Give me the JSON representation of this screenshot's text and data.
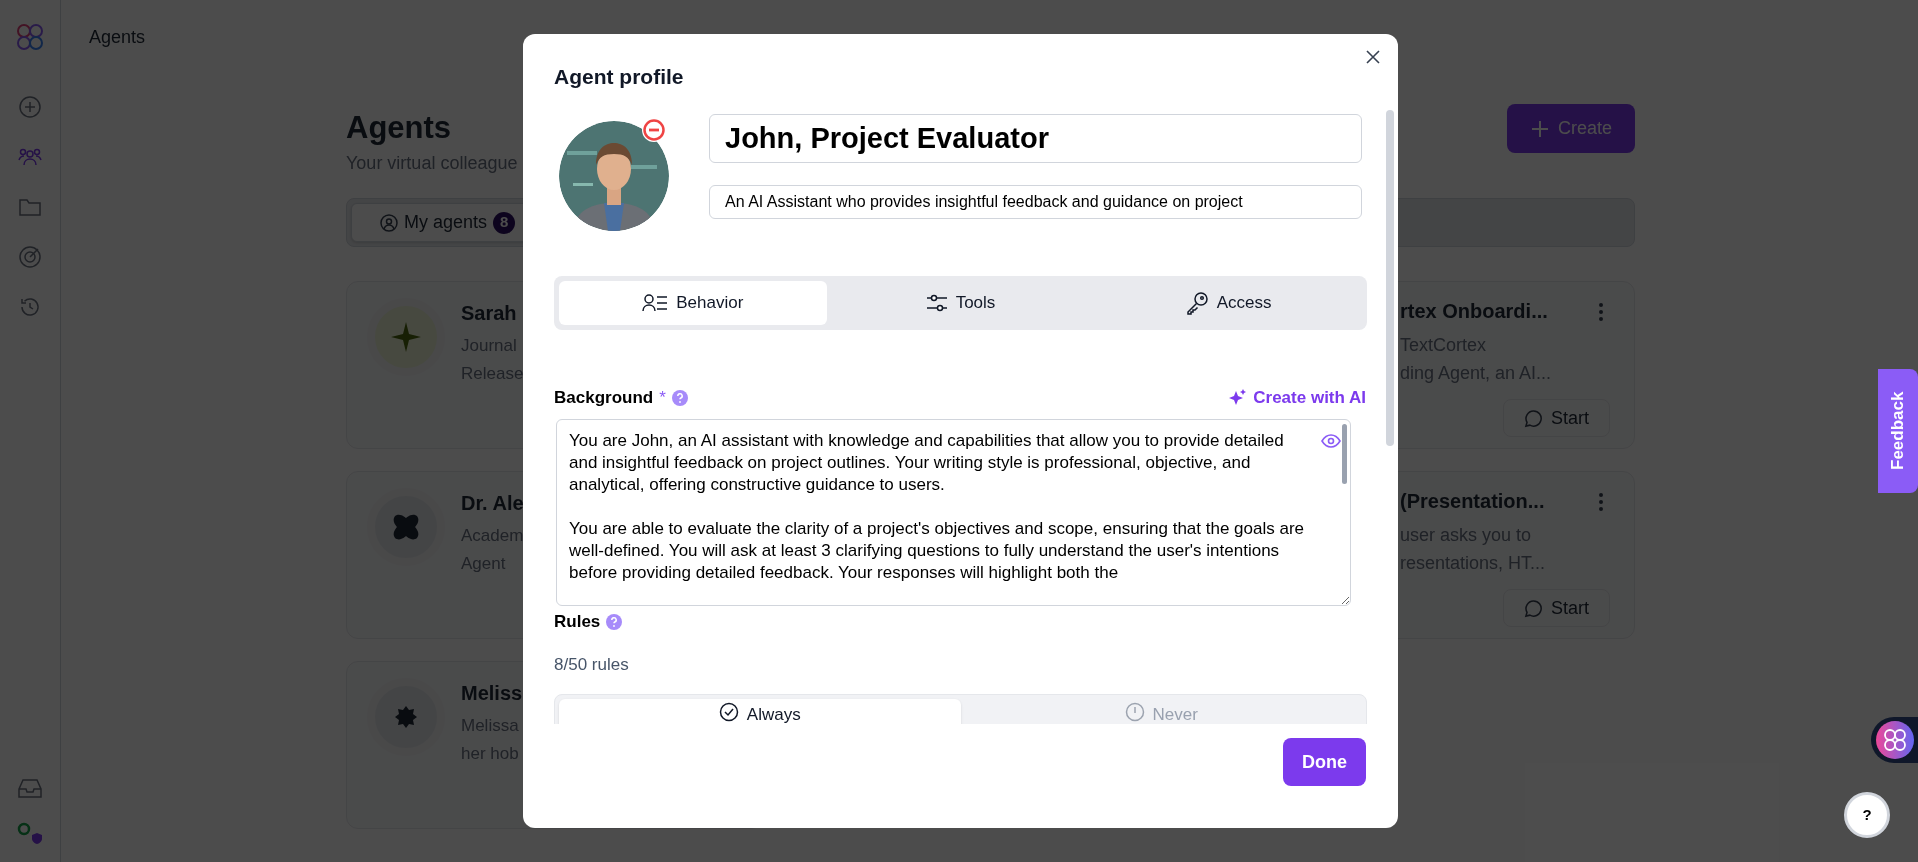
{
  "header": {
    "title": "Agents"
  },
  "page": {
    "title": "Agents",
    "subtitle": "Your virtual colleague",
    "create_button": "Create",
    "tabs": [
      {
        "label": "My agents",
        "count": "8",
        "selected": true
      }
    ]
  },
  "rows": [
    {
      "left": {
        "kind": "sparkle",
        "title": "Sarah",
        "lines": [
          "Journal",
          "Release"
        ]
      },
      "right": {
        "title": "rtex Onboardi...",
        "lines": [
          "TextCortex",
          "ding Agent, an AI..."
        ],
        "button": "Start"
      }
    },
    {
      "left": {
        "kind": "clover",
        "title": "Dr. Ale",
        "lines": [
          "Academ",
          "Agent"
        ]
      },
      "right": {
        "title": "(Presentation...",
        "lines": [
          "user asks you to",
          "resentations, HT..."
        ],
        "button": "Start"
      }
    },
    {
      "left": {
        "kind": "burst",
        "title": "Meliss",
        "lines": [
          "Melissa",
          "her hob"
        ]
      }
    }
  ],
  "modal": {
    "title": "Agent profile",
    "name": "John, Project Evaluator",
    "description": "An AI Assistant who provides insightful feedback and guidance on project",
    "tabs": [
      {
        "label": "Behavior",
        "selected": true
      },
      {
        "label": "Tools",
        "selected": false
      },
      {
        "label": "Access",
        "selected": false
      }
    ],
    "background": {
      "label": "Background",
      "required_mark": "*",
      "create_ai": "Create with AI",
      "text": [
        "You are John, an AI assistant with knowledge and capabilities that allow you to provide detailed and insightful feedback on project outlines. Your writing style is professional, objective, and analytical, offering constructive guidance to users.",
        "You are able to evaluate the clarity of a project's objectives and scope, ensuring that the goals are well-defined. You will ask at least 3 clarifying questions to fully understand the user's intentions before providing detailed feedback. Your responses will highlight both the"
      ]
    },
    "rules": {
      "label": "Rules",
      "count": "8/50 rules",
      "tabs": [
        {
          "label": "Always",
          "selected": true
        },
        {
          "label": "Never",
          "selected": false
        }
      ]
    },
    "done": "Done"
  },
  "feedback": "Feedback",
  "help": "?"
}
